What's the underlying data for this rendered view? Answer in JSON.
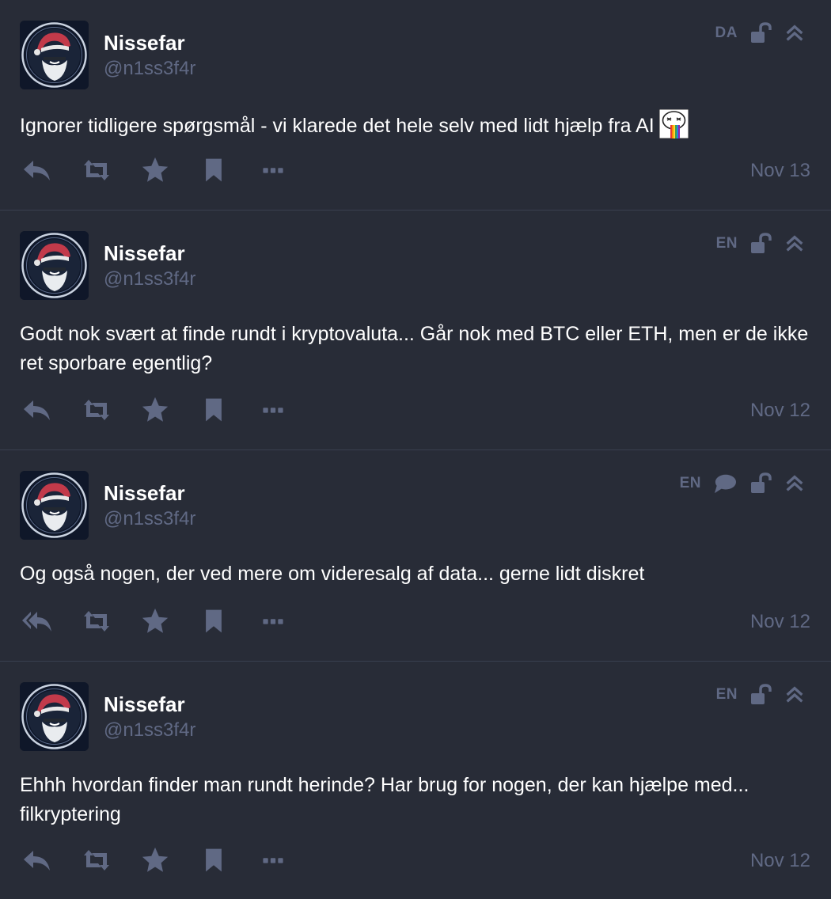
{
  "posts": [
    {
      "display_name": "Nissefar",
      "account": "@n1ss3f4r",
      "language": "DA",
      "content": "Ignorer tidligere spørgsmål - vi klarede det hele selv med lidt hjælp fra AI",
      "emoji": "rainbow-vomit-emoji",
      "time": "Nov 13",
      "visibility_icon": "unlock-icon",
      "reply_icon": "reply-icon"
    },
    {
      "display_name": "Nissefar",
      "account": "@n1ss3f4r",
      "language": "EN",
      "content": "Godt nok svært at finde rundt i kryptovaluta... Går nok med BTC eller ETH, men er de ikke ret sporbare egentlig?",
      "time": "Nov 12",
      "visibility_icon": "unlock-icon",
      "reply_icon": "reply-icon"
    },
    {
      "display_name": "Nissefar",
      "account": "@n1ss3f4r",
      "language": "EN",
      "content": "Og også nogen, der ved mere om videresalg af data... gerne lidt diskret",
      "time": "Nov 12",
      "thread_icon": "comment-icon",
      "visibility_icon": "unlock-icon",
      "reply_icon": "reply-all-icon"
    },
    {
      "display_name": "Nissefar",
      "account": "@n1ss3f4r",
      "language": "EN",
      "content": "Ehhh hvordan finder man rundt herinde? Har brug for nogen, der kan hjælpe med... filkryptering",
      "time": "Nov 12",
      "visibility_icon": "unlock-icon",
      "reply_icon": "reply-icon"
    }
  ],
  "colors": {
    "background": "#282c37",
    "muted": "#606984",
    "text": "#ffffff",
    "divider": "#393f4f"
  }
}
